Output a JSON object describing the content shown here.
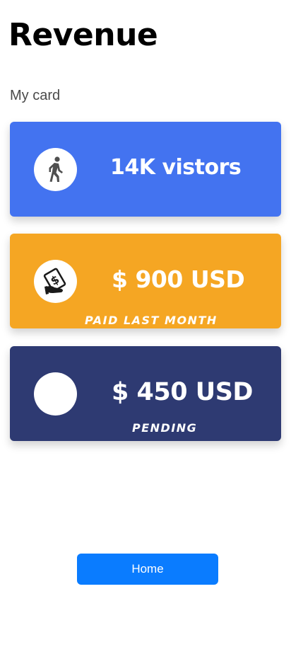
{
  "header": {
    "title": "Revenue"
  },
  "section": {
    "label": "My card"
  },
  "cards": [
    {
      "value": "14K vistors",
      "icon": "walking-person-icon",
      "color": "#4373f0"
    },
    {
      "value": "$ 900 USD",
      "caption": "PAID LAST MONTH",
      "icon": "dollar-document-icon",
      "color": "#f5a623"
    },
    {
      "value": "$ 450 USD",
      "caption": "PENDING",
      "icon": "blank-circle-icon",
      "color": "#2e3a72"
    }
  ],
  "footer": {
    "home_label": "Home",
    "button_color": "#0a7cff"
  }
}
